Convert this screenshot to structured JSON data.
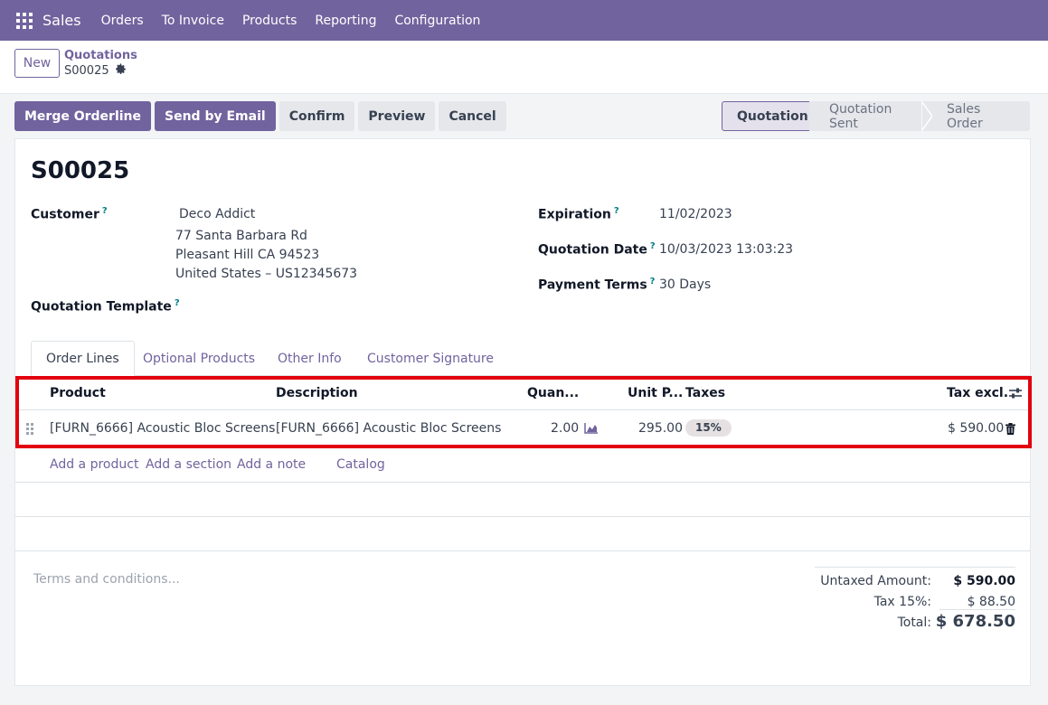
{
  "nav": {
    "brand": "Sales",
    "items": [
      "Orders",
      "To Invoice",
      "Products",
      "Reporting",
      "Configuration"
    ]
  },
  "controlpanel": {
    "new_label": "New",
    "breadcrumb": "Quotations",
    "record": "S00025"
  },
  "actions": {
    "merge": "Merge Orderline",
    "send": "Send by Email",
    "confirm": "Confirm",
    "preview": "Preview",
    "cancel": "Cancel"
  },
  "status": {
    "stages": [
      "Quotation",
      "Quotation Sent",
      "Sales Order"
    ],
    "active": "Quotation"
  },
  "form": {
    "title": "S00025",
    "customer_label": "Customer",
    "customer_name": "Deco Addict",
    "address_1": "77 Santa Barbara Rd",
    "address_2": "Pleasant Hill CA 94523",
    "address_3": "United States – US12345673",
    "template_label": "Quotation Template",
    "expiration_label": "Expiration",
    "expiration_value": "11/02/2023",
    "qdate_label": "Quotation Date",
    "qdate_value": "10/03/2023 13:03:23",
    "terms_label": "Payment Terms",
    "terms_value": "30 Days",
    "help_mark": "?"
  },
  "tabs": [
    "Order Lines",
    "Optional Products",
    "Other Info",
    "Customer Signature"
  ],
  "table": {
    "headers": {
      "product": "Product",
      "description": "Description",
      "quantity": "Quan...",
      "unit_price": "Unit P...",
      "taxes": "Taxes",
      "subtotal": "Tax excl."
    },
    "rows": [
      {
        "product": "[FURN_6666] Acoustic Bloc Screens",
        "description": "[FURN_6666] Acoustic Bloc Screens",
        "quantity": "2.00",
        "unit_price": "295.00",
        "tax": "15%",
        "subtotal": "$ 590.00"
      }
    ],
    "add_links": [
      "Add a product",
      "Add a section",
      "Add a note",
      "Catalog"
    ]
  },
  "footer": {
    "terms_placeholder": "Terms and conditions...",
    "untaxed_label": "Untaxed Amount:",
    "untaxed_value": "$ 590.00",
    "tax_label": "Tax 15%:",
    "tax_value": "$ 88.50",
    "total_label": "Total:",
    "total_value": "$ 678.50"
  }
}
